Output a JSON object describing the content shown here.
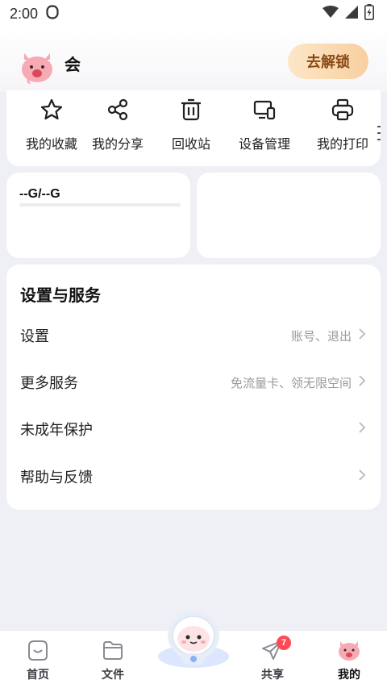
{
  "status_bar": {
    "time": "2:00"
  },
  "profile": {
    "username": "会",
    "unlock_label": "去解锁"
  },
  "quick_actions": [
    {
      "label": "我的收藏",
      "icon": "star-icon"
    },
    {
      "label": "我的分享",
      "icon": "share-icon"
    },
    {
      "label": "回收站",
      "icon": "trash-icon"
    },
    {
      "label": "设备管理",
      "icon": "device-icon"
    },
    {
      "label": "我的打印",
      "icon": "printer-icon"
    }
  ],
  "storage": {
    "usage_text": "--G/--G"
  },
  "settings": {
    "title": "设置与服务",
    "rows": [
      {
        "label": "设置",
        "sub": "账号、退出"
      },
      {
        "label": "更多服务",
        "sub": "免流量卡、领无限空间"
      },
      {
        "label": "未成年保护",
        "sub": ""
      },
      {
        "label": "帮助与反馈",
        "sub": ""
      }
    ]
  },
  "bottom_nav": {
    "items": [
      {
        "label": "首页",
        "icon": "home-icon"
      },
      {
        "label": "文件",
        "icon": "folder-icon"
      },
      {
        "label": "共享",
        "icon": "send-icon",
        "badge": "7"
      },
      {
        "label": "我的",
        "icon": "profile-avatar-icon"
      }
    ]
  },
  "colors": {
    "accent_unlock_start": "#fde7c7",
    "accent_unlock_end": "#f8cfa0",
    "unlock_text": "#8a4a15",
    "badge": "#ff4a55",
    "page_bg": "#eef0f5"
  }
}
